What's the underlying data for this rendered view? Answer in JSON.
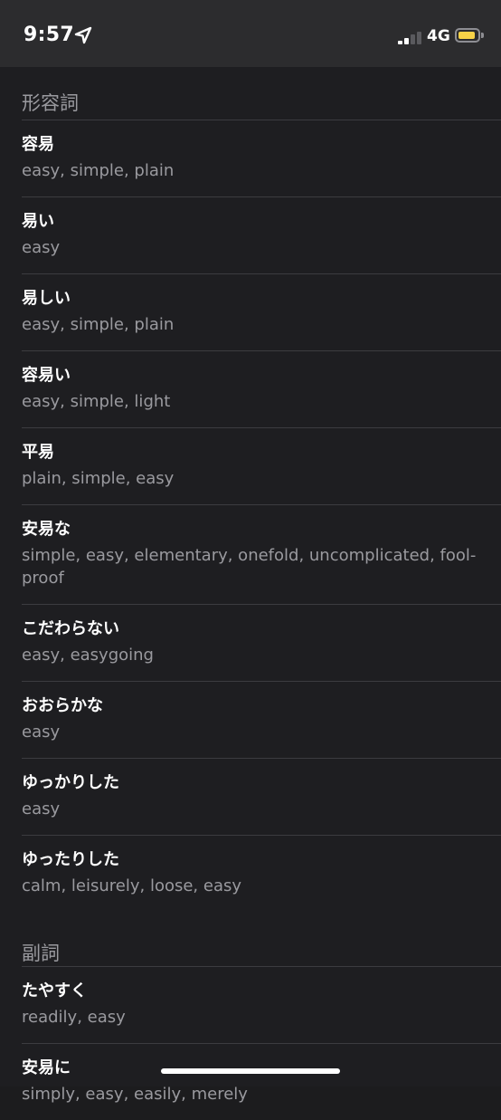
{
  "status_bar": {
    "time": "9:57",
    "network": "4G",
    "battery_fill": 0.9,
    "battery_color": "#f7d247",
    "signal_bars_active": 2,
    "signal_bars_total": 4,
    "icons": [
      "location-arrow-icon",
      "cellular-signal-icon",
      "battery-icon"
    ]
  },
  "sections": [
    {
      "title": "形容詞",
      "entries": [
        {
          "term": "容易",
          "meaning": "easy, simple, plain"
        },
        {
          "term": "易い",
          "meaning": "easy"
        },
        {
          "term": "易しい",
          "meaning": "easy, simple, plain"
        },
        {
          "term": "容易い",
          "meaning": "easy, simple, light"
        },
        {
          "term": "平易",
          "meaning": "plain, simple, easy"
        },
        {
          "term": "安易な",
          "meaning": "simple, easy, elementary, onefold, uncomplicated, fool-proof"
        },
        {
          "term": "こだわらない",
          "meaning": "easy, easygoing"
        },
        {
          "term": "おおらかな",
          "meaning": "easy"
        },
        {
          "term": "ゆっかりした",
          "meaning": "easy"
        },
        {
          "term": "ゆったりした",
          "meaning": "calm, leisurely, loose, easy"
        }
      ]
    },
    {
      "title": "副詞",
      "entries": [
        {
          "term": "たやすく",
          "meaning": "readily, easy"
        },
        {
          "term": "安易に",
          "meaning": "simply, easy, easily, merely"
        }
      ]
    }
  ],
  "colors": {
    "background": "#1e1e21",
    "status_bar_bg": "#2c2c2e",
    "primary_text": "#ffffff",
    "secondary_text": "#9a9a9f",
    "separator": "#3c3c40"
  }
}
